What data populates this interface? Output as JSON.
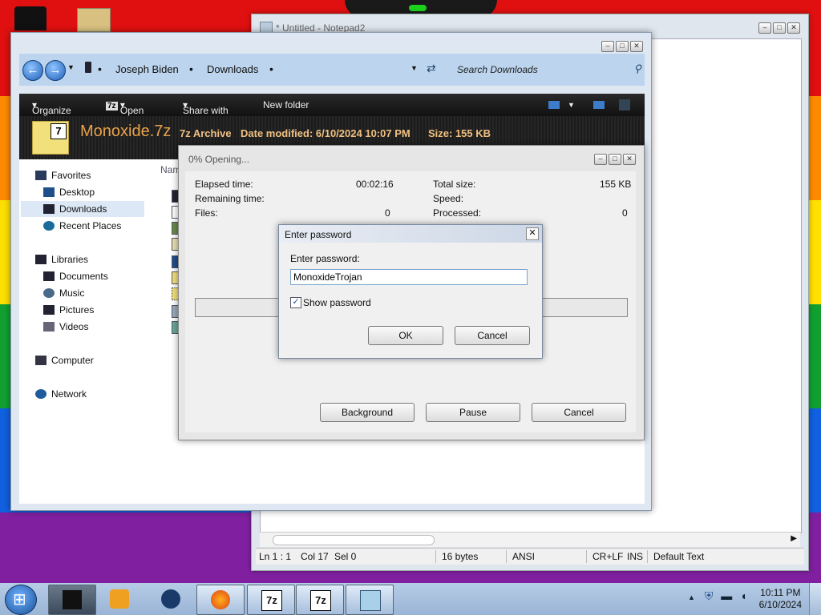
{
  "notepad": {
    "title": "* Untitled - Notepad2",
    "status": {
      "position": "Ln 1 : 1",
      "col": "Col 17",
      "sel": "Sel 0",
      "size": "16 bytes",
      "encoding": "ANSI",
      "eol": "CR+LF",
      "ins": "INS",
      "scheme": "Default Text"
    }
  },
  "explorer": {
    "breadcrumb": [
      "Joseph Biden",
      "Downloads"
    ],
    "search_placeholder": "Search Downloads",
    "toolbar": {
      "organize": "Organize",
      "open": "Open",
      "share_with": "Share with",
      "new_folder": "New folder"
    },
    "details": {
      "filename": "Monoxide.7z",
      "type": "7z Archive",
      "modified": "Date modified: 6/10/2024 10:07 PM",
      "size": "Size: 155 KB"
    },
    "column_header": "Nam",
    "nav": {
      "favorites": "Favorites",
      "desktop": "Desktop",
      "downloads": "Downloads",
      "recent_places": "Recent Places",
      "libraries": "Libraries",
      "documents": "Documents",
      "music": "Music",
      "pictures": "Pictures",
      "videos": "Videos",
      "computer": "Computer",
      "network": "Network"
    }
  },
  "progress": {
    "title": "0% Opening...",
    "elapsed_label": "Elapsed time:",
    "elapsed_value": "00:02:16",
    "remaining_label": "Remaining time:",
    "files_label": "Files:",
    "files_value": "0",
    "total_size_label": "Total size:",
    "total_size_value": "155 KB",
    "speed_label": "Speed:",
    "processed_label": "Processed:",
    "processed_value": "0",
    "progress_fraction": 0,
    "background_btn": "Background",
    "pause_btn": "Pause",
    "cancel_btn": "Cancel"
  },
  "password": {
    "title": "Enter password",
    "label": "Enter password:",
    "value": "MonoxideTrojan",
    "show_password_label": "Show password",
    "show_password_checked": true,
    "ok_btn": "OK",
    "cancel_btn": "Cancel"
  },
  "taskbar": {
    "time": "10:11 PM",
    "date": "6/10/2024",
    "seven_zip_label_1": "7z",
    "seven_zip_label_2": "7z"
  },
  "colors": {
    "accent": "#1f5fb8",
    "details_text": "#e8a24a"
  }
}
